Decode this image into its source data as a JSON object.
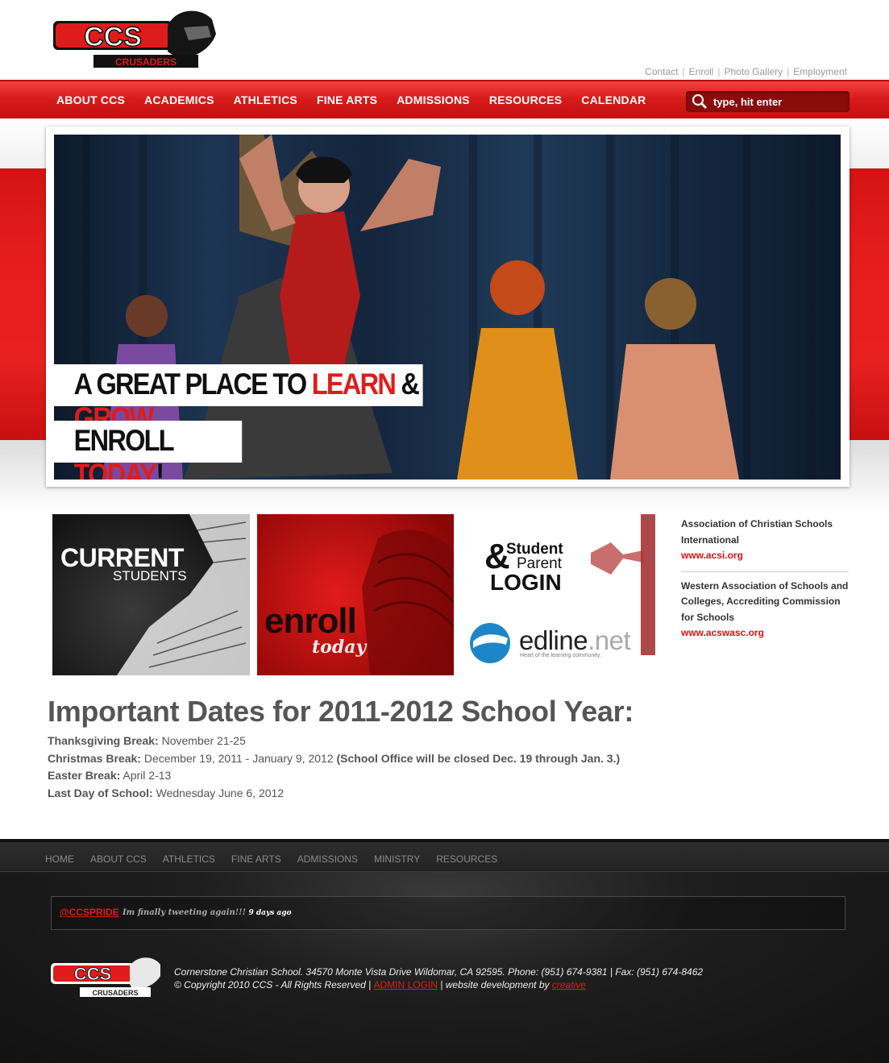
{
  "brand": {
    "logo_text": "CCS",
    "logo_sub": "CRUSADERS"
  },
  "top_links": [
    "Contact",
    "Enroll",
    "Photo Gallery",
    "Employment"
  ],
  "nav": [
    "ABOUT CCS",
    "ACADEMICS",
    "ATHLETICS",
    "FINE ARTS",
    "ADMISSIONS",
    "RESOURCES",
    "CALENDAR"
  ],
  "search": {
    "placeholder": "type, hit enter"
  },
  "hero": {
    "line1_a": "A GREAT PLACE TO ",
    "line1_b": "LEARN",
    "line1_c": " & ",
    "line1_d": "GROW",
    "line2_a": "ENROLL ",
    "line2_b": "TODAY",
    "line2_c": "!"
  },
  "tiles": {
    "current_1": "CURRENT",
    "current_2": "STUDENTS",
    "enroll_1": "enroll",
    "enroll_2": "today",
    "login_amp": "&",
    "login_student": "Student",
    "login_parent": "Parent",
    "login_login": "LOGIN",
    "edline_a": "edline",
    "edline_b": ".net",
    "edline_tag": "Heart of the learning community."
  },
  "sidebar": [
    {
      "org": "Association of Christian Schools International",
      "link": "www.acsi.org"
    },
    {
      "org": "Western Association of Schools and Colleges, Accrediting Commission for Schools",
      "link": "www.acswasc.org"
    }
  ],
  "dates": {
    "title": "Important Dates for 2011-2012 School Year:",
    "items": [
      {
        "label": "Thanksgiving Break:",
        "value": " November 21-25",
        "note": ""
      },
      {
        "label": "Christmas Break:",
        "value": " December 19, 2011 - January 9, 2012 ",
        "note": "(School Office will be closed Dec. 19 through Jan. 3.)"
      },
      {
        "label": "Easter Break:",
        "value": " April 2-13",
        "note": ""
      },
      {
        "label": "Last Day of School:",
        "value": " Wednesday June 6, 2012",
        "note": ""
      }
    ]
  },
  "footer": {
    "nav": [
      "HOME",
      "ABOUT CCS",
      "ATHLETICS",
      "FINE ARTS",
      "ADMISSIONS",
      "MINISTRY",
      "RESOURCES"
    ],
    "tweet_handle": "@CCSPRIDE",
    "tweet_text": "Im finally tweeting again!!!",
    "tweet_time": "9 days ago",
    "address": "Cornerstone Christian School. 34570 Monte Vista Drive Wildomar, CA 92595. Phone: (951) 674-9381 | Fax: (951) 674-8462",
    "copyright": "© Copyright 2010 CCS - All Rights Reserved | ",
    "admin_login": "ADMIN LOGIN",
    "dev_text": " | website development by ",
    "dev_link": "creative"
  }
}
